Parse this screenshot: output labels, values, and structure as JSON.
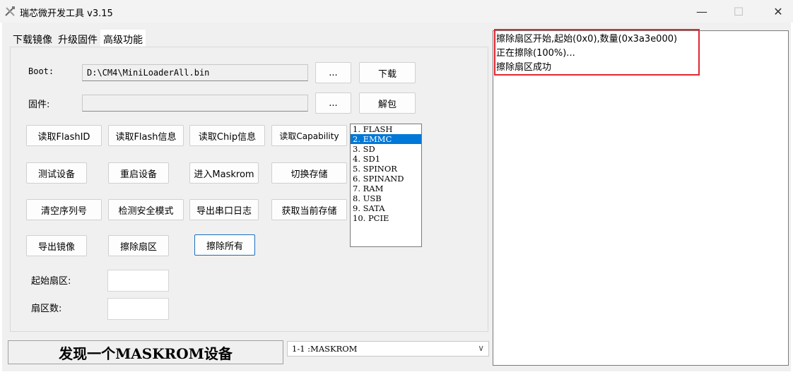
{
  "window": {
    "title": "瑞芯微开发工具 v3.15",
    "minimize_glyph": "—",
    "maximize_glyph": "☐",
    "close_glyph": "✕"
  },
  "tabs": [
    {
      "label": "下载镜像"
    },
    {
      "label": "升级固件"
    },
    {
      "label": "高级功能"
    }
  ],
  "boot": {
    "label": "Boot:",
    "path": "D:\\CM4\\MiniLoaderAll.bin",
    "browse": "...",
    "action": "下载"
  },
  "firmware": {
    "label": "固件:",
    "path": "",
    "browse": "...",
    "action": "解包"
  },
  "buttons": {
    "read_flash_id": "读取FlashID",
    "read_flash_info": "读取Flash信息",
    "read_chip_info": "读取Chip信息",
    "read_capability": "读取Capability",
    "test_device": "测试设备",
    "reboot_device": "重启设备",
    "enter_maskrom": "进入Maskrom",
    "switch_storage": "切换存储",
    "clear_serial": "清空序列号",
    "check_secure_mode": "检测安全模式",
    "export_uart_log": "导出串口日志",
    "get_current_storage": "获取当前存储",
    "export_image": "导出镜像",
    "erase_sector": "擦除扇区",
    "erase_all": "擦除所有"
  },
  "storage_list": {
    "items": [
      "1. FLASH",
      "2. EMMC",
      "3. SD",
      "4. SD1",
      "5. SPINOR",
      "6. SPINAND",
      "7. RAM",
      "8. USB",
      "9. SATA",
      "10. PCIE"
    ],
    "selected_index": 1
  },
  "start_sector": {
    "label": "起始扇区:",
    "value": ""
  },
  "sector_count": {
    "label": "扇区数:",
    "value": ""
  },
  "status": {
    "text": "发现一个MASKROM设备"
  },
  "device_select": {
    "value": "1-1 :MASKROM"
  },
  "log": {
    "lines": [
      "擦除扇区开始,起始(0x0),数量(0x3a3e000)",
      "正在擦除(100%)...",
      "擦除扇区成功"
    ]
  },
  "colors": {
    "selection": "#0078d7",
    "highlight_box": "#e0282e",
    "focus_border": "#1b6fbf"
  }
}
